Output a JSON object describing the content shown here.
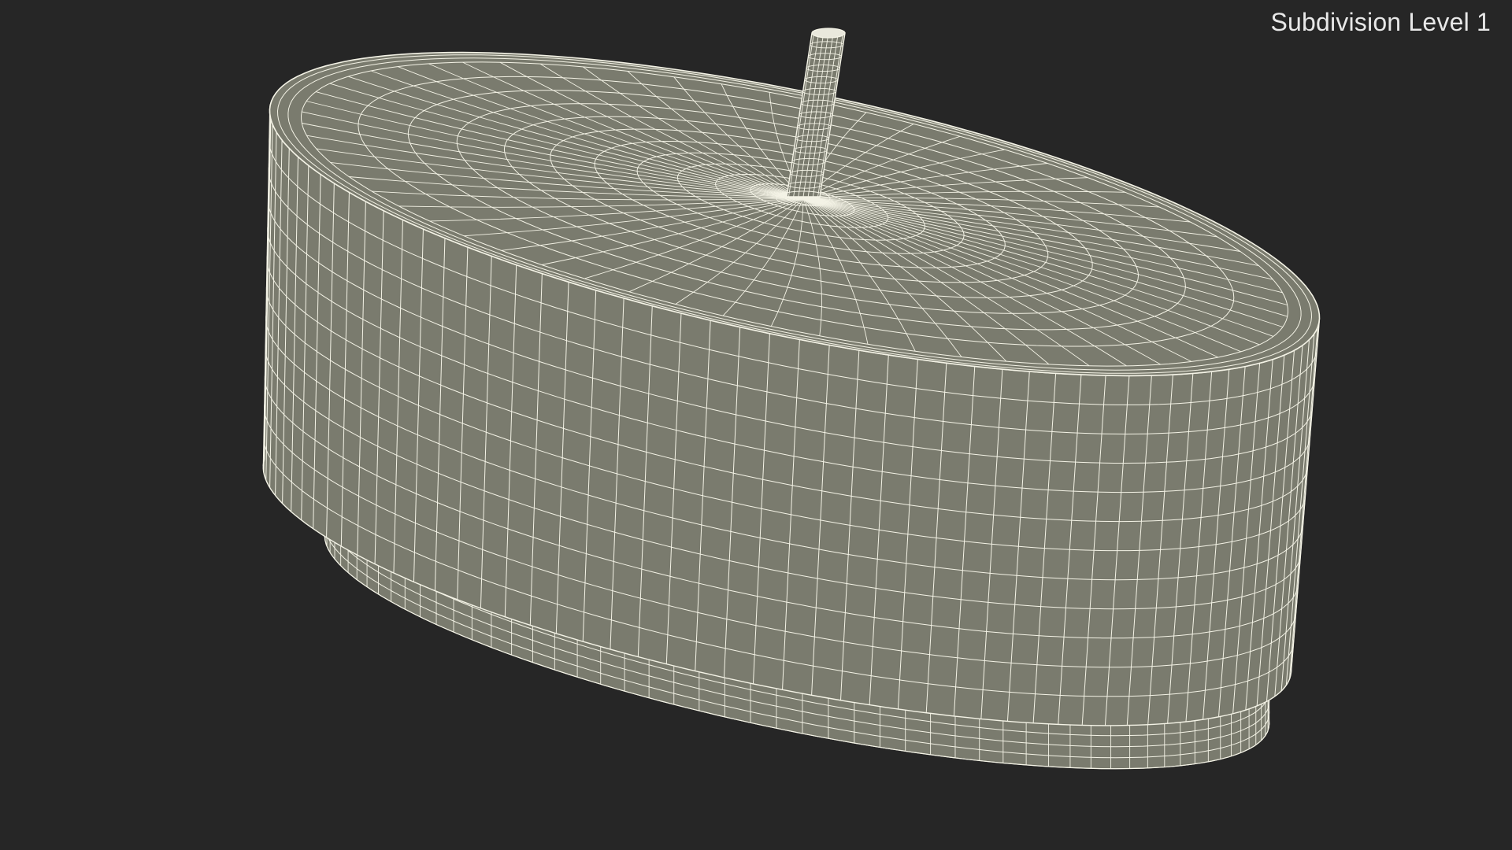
{
  "viewport": {
    "background": "#262626",
    "label": "Subdivision Level 1"
  },
  "model": {
    "render_mode": "wireframe",
    "shape": "cylinder-disc-with-pin",
    "surface_color": "#7a7b6e",
    "wire_color": "#f4f3e6"
  }
}
